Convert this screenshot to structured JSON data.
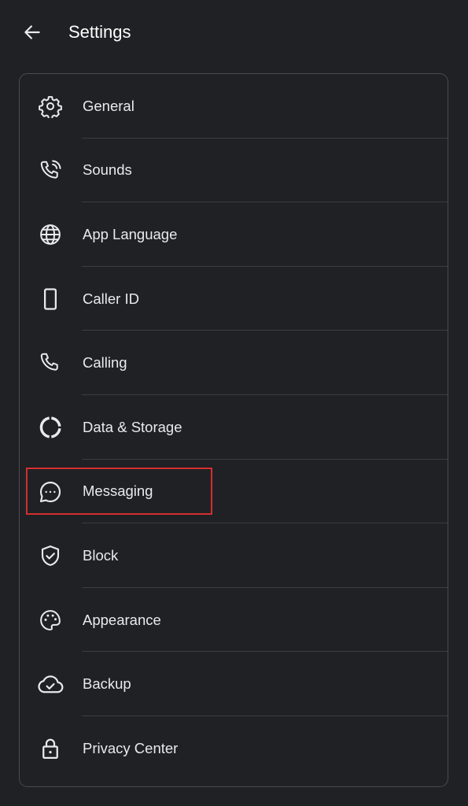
{
  "header": {
    "title": "Settings",
    "back_icon": "arrow-left-icon"
  },
  "menu": {
    "items": [
      {
        "label": "General",
        "icon": "gear-icon"
      },
      {
        "label": "Sounds",
        "icon": "phone-ringing-icon"
      },
      {
        "label": "App Language",
        "icon": "globe-icon"
      },
      {
        "label": "Caller ID",
        "icon": "smartphone-icon"
      },
      {
        "label": "Calling",
        "icon": "phone-icon"
      },
      {
        "label": "Data & Storage",
        "icon": "donut-icon"
      },
      {
        "label": "Messaging",
        "icon": "chat-bubble-icon"
      },
      {
        "label": "Block",
        "icon": "shield-check-icon"
      },
      {
        "label": "Appearance",
        "icon": "palette-icon"
      },
      {
        "label": "Backup",
        "icon": "cloud-check-icon"
      },
      {
        "label": "Privacy Center",
        "icon": "lock-icon"
      }
    ]
  },
  "highlight": {
    "target": "Messaging",
    "color": "#d32f2f"
  },
  "colors": {
    "background": "#202124",
    "text": "#e8eaed",
    "icon": "#e8eaed",
    "divider": "#3c3d41",
    "card_border": "#4a4b4f"
  }
}
